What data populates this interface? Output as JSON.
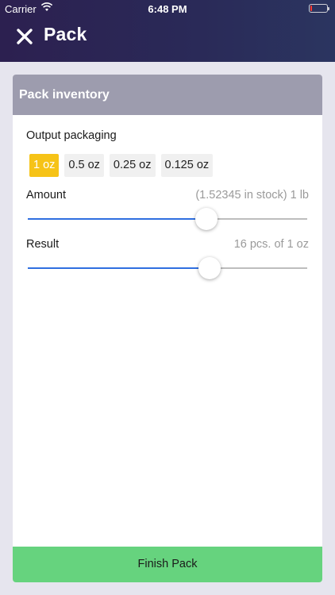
{
  "status_bar": {
    "carrier": "Carrier",
    "time": "6:48 PM",
    "battery_level": 0.12
  },
  "header": {
    "title": "Pack",
    "close_icon": "close-icon"
  },
  "card": {
    "title": "Pack inventory",
    "output_packaging": {
      "label": "Output packaging",
      "options": [
        "1 oz",
        "0.5 oz",
        "0.25 oz",
        "0.125 oz"
      ],
      "selected": "1 oz"
    },
    "amount": {
      "label": "Amount",
      "value_text": "(1.52345 in stock) 1 lb",
      "slider_fraction": 0.64
    },
    "result": {
      "label": "Result",
      "value_text": "16 pcs. of 1 oz",
      "slider_fraction": 0.65
    },
    "finish_label": "Finish Pack"
  },
  "colors": {
    "header_start": "#2c2050",
    "card_header": "#9d9cae",
    "selected_option": "#f6c317",
    "slider_active": "#2f6fe0",
    "finish_button": "#66d37e"
  }
}
